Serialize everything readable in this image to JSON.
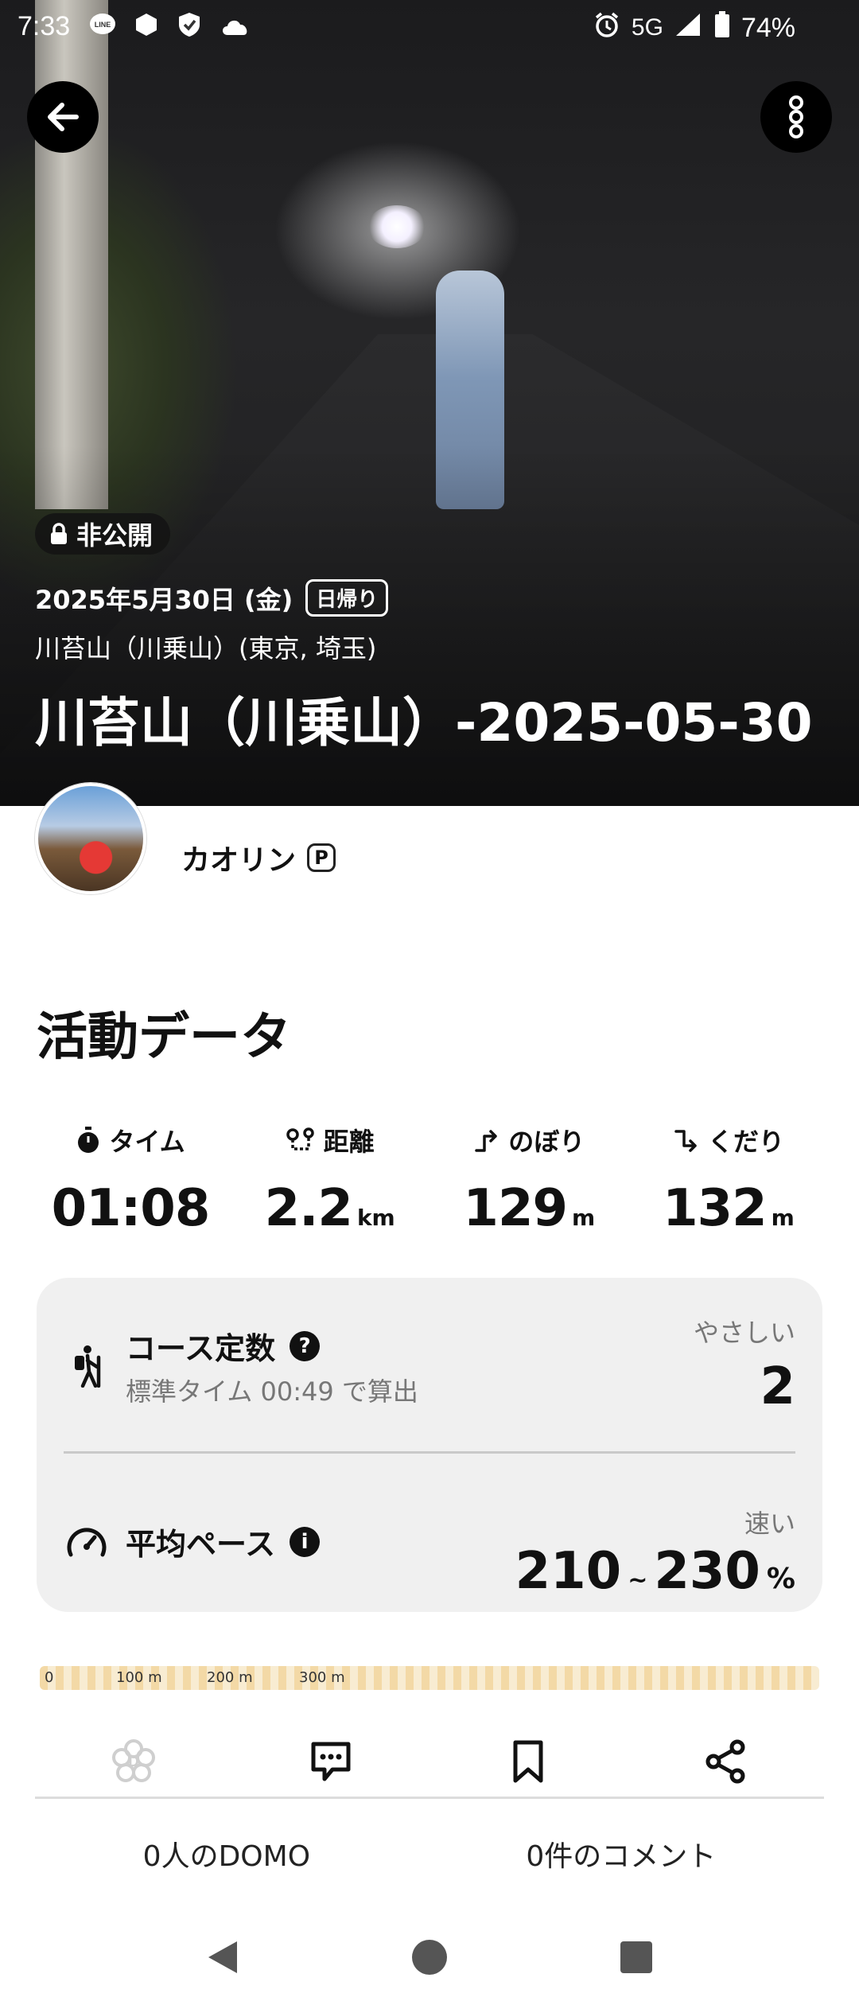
{
  "status_bar": {
    "time": "7:33",
    "network": "5G",
    "battery": "74%",
    "icons": [
      "line-icon",
      "app-icon",
      "shield-check-icon",
      "cloud-icon",
      "alarm-icon",
      "signal-icon",
      "battery-icon"
    ]
  },
  "hero": {
    "private_label": "非公開",
    "date": "2025年5月30日 (金)",
    "trip_type": "日帰り",
    "location": "川苔山（川乗山）(東京, 埼玉)",
    "title": "川苔山（川乗山）-2025-05-30"
  },
  "user": {
    "name": "カオリン",
    "premium_mark": "P"
  },
  "activity": {
    "section_title": "活動データ",
    "stats": [
      {
        "label": "タイム",
        "value": "01:08",
        "unit": "",
        "icon": "stopwatch-icon"
      },
      {
        "label": "距離",
        "value": "2.2",
        "unit": "km",
        "icon": "route-icon"
      },
      {
        "label": "のぼり",
        "value": "129",
        "unit": "m",
        "icon": "ascent-icon"
      },
      {
        "label": "くだり",
        "value": "132",
        "unit": "m",
        "icon": "descent-icon"
      }
    ]
  },
  "course": {
    "label": "コース定数",
    "sub": "標準タイム 00:49 で算出",
    "tag": "やさしい",
    "value": "2"
  },
  "pace": {
    "label": "平均ペース",
    "tag": "速い",
    "low": "210",
    "tilde": "~",
    "high": "230",
    "unit": "%"
  },
  "map_scale": [
    "0",
    "100 m",
    "200 m",
    "300 m"
  ],
  "actions": {
    "domo_count": "0人のDOMO",
    "comment_count": "0件のコメント"
  },
  "colors": {
    "accent_track": "#e8a317",
    "card_bg": "#f0f0f0"
  }
}
